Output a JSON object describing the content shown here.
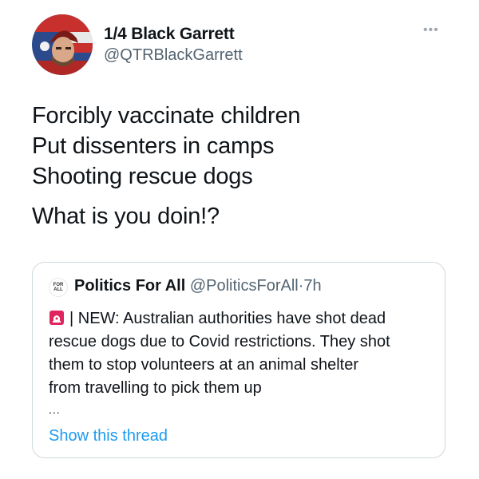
{
  "author": {
    "display_name": "1/4 Black Garrett",
    "handle": "@QTRBlackGarrett"
  },
  "more_icon": "more-dots-icon",
  "tweet": {
    "lines": [
      "Forcibly vaccinate children",
      "Put dissenters in camps",
      "Shooting rescue dogs",
      "What is you doin!?"
    ]
  },
  "quoted": {
    "logo_text": "FOR ALL",
    "display_name": "Politics For All",
    "handle": "@PoliticsForAll",
    "separator": "·",
    "time": "7h",
    "icon": "siren-icon",
    "body_lines": [
      "| NEW: Australian authorities have shot dead",
      "rescue dogs due to Covid restrictions. They shot",
      "them to stop volunteers at an animal shelter",
      "from travelling to pick them up"
    ],
    "ellipsis": "...",
    "show_thread": "Show this thread"
  },
  "colors": {
    "link": "#1d9bf0",
    "secondary_text": "#536471",
    "border": "#cfd9de"
  }
}
